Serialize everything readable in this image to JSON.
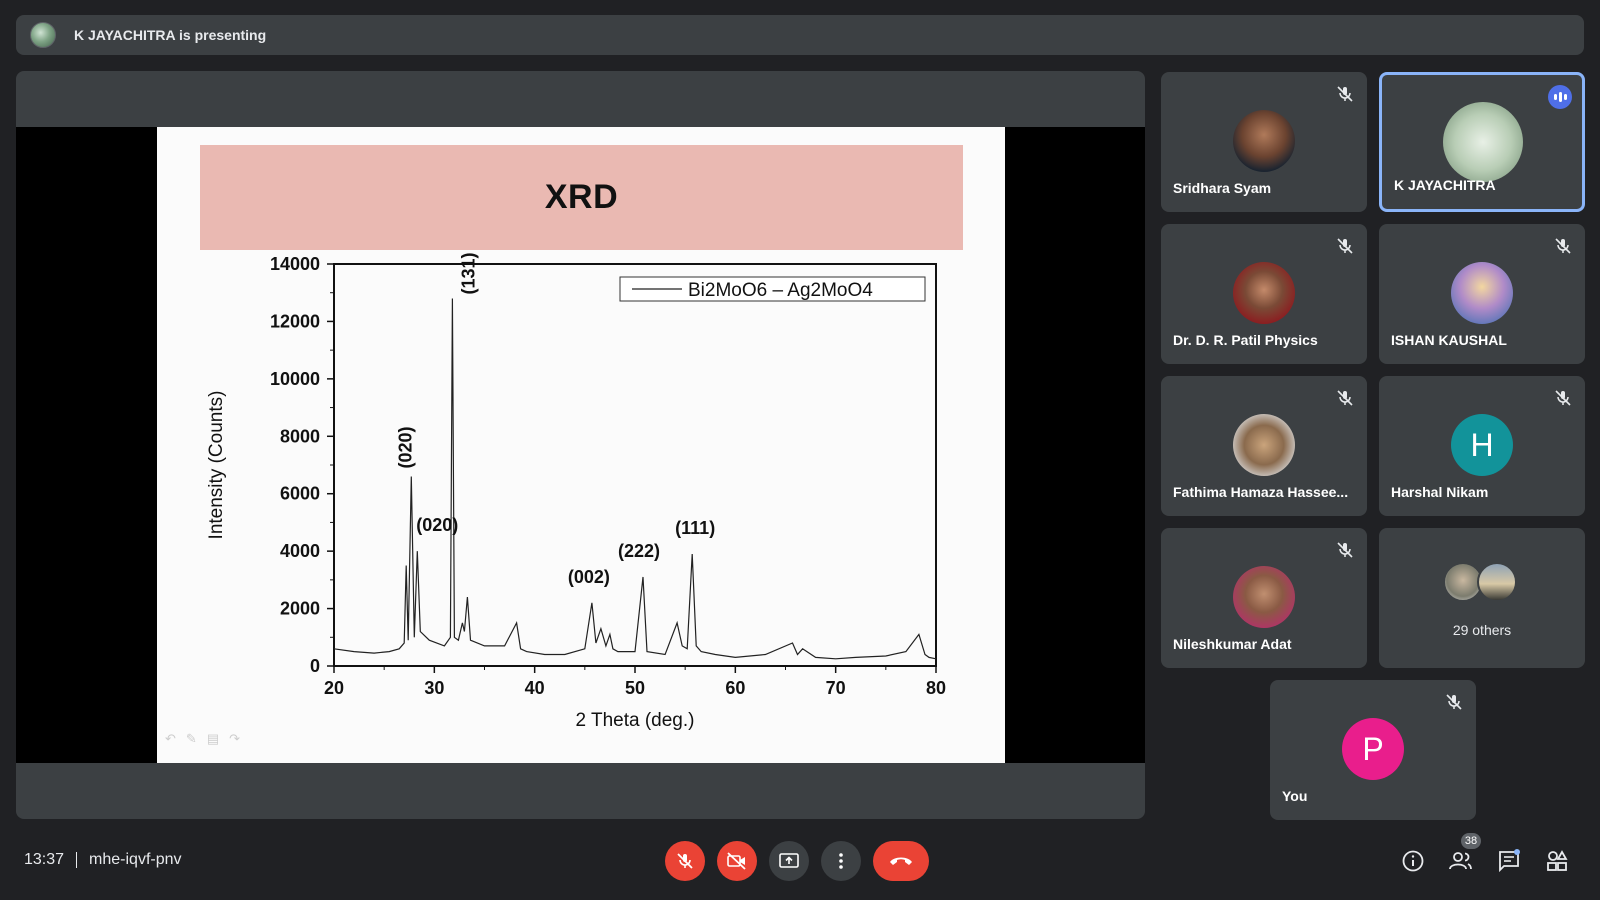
{
  "presenting": {
    "text": "K JAYACHITRA is presenting"
  },
  "slide": {
    "title": "XRD",
    "peak_labels": [
      "(131)",
      "(020)",
      "(020)",
      "(002)",
      "(222)",
      "(111)"
    ]
  },
  "chart_data": {
    "type": "line",
    "xlabel": "2 Theta (deg.)",
    "ylabel": "Intensity (Counts)",
    "xlim": [
      20,
      80
    ],
    "ylim": [
      0,
      14000
    ],
    "x_ticks": [
      "20",
      "30",
      "40",
      "50",
      "60",
      "70",
      "80"
    ],
    "y_ticks": [
      "0",
      "2000",
      "4000",
      "6000",
      "8000",
      "10000",
      "12000",
      "14000"
    ],
    "legend_position": "top-right",
    "series": [
      {
        "name": "Bi2MoO6 – Ag2MoO4",
        "x": [
          20,
          22,
          24,
          25.5,
          26.5,
          27.0,
          27.2,
          27.4,
          27.7,
          28.0,
          28.3,
          28.6,
          29.5,
          31.0,
          31.6,
          31.8,
          32.0,
          32.4,
          32.8,
          33.0,
          33.3,
          33.6,
          35,
          37,
          38.2,
          38.6,
          39.2,
          41,
          43,
          45.0,
          45.7,
          46.1,
          46.6,
          47.1,
          47.5,
          47.8,
          48.3,
          50.0,
          50.8,
          51.2,
          53.0,
          54.2,
          54.7,
          55.2,
          55.7,
          56.1,
          56.6,
          58,
          60,
          63,
          65.7,
          66.2,
          66.7,
          68,
          70,
          72,
          75,
          77,
          78.3,
          78.9,
          79.3,
          80
        ],
        "values": [
          600,
          500,
          450,
          500,
          600,
          800,
          3500,
          900,
          6600,
          1000,
          4000,
          1200,
          900,
          700,
          1000,
          12800,
          1000,
          900,
          1500,
          1200,
          2400,
          900,
          700,
          700,
          1500,
          600,
          500,
          400,
          400,
          600,
          2200,
          800,
          1300,
          700,
          1100,
          600,
          500,
          500,
          3100,
          500,
          400,
          1500,
          700,
          600,
          3900,
          700,
          500,
          400,
          300,
          400,
          800,
          400,
          600,
          300,
          250,
          300,
          350,
          500,
          1100,
          400,
          300,
          250
        ]
      }
    ],
    "annotations": [
      {
        "text": "(131)",
        "x": 32.0,
        "y": 12800
      },
      {
        "text": "(020)",
        "x": 27.7,
        "y": 6600
      },
      {
        "text": "(020)",
        "x": 28.3,
        "y": 4000
      },
      {
        "text": "(002)",
        "x": 45.7,
        "y": 2200
      },
      {
        "text": "(222)",
        "x": 50.8,
        "y": 3100
      },
      {
        "text": "(111)",
        "x": 55.7,
        "y": 3900
      }
    ]
  },
  "participants": [
    {
      "name": "Sridhara Syam",
      "muted": true
    },
    {
      "name": "K JAYACHITRA",
      "speaking": true
    },
    {
      "name": "Dr. D. R. Patil Physics",
      "muted": true
    },
    {
      "name": "ISHAN KAUSHAL",
      "muted": true
    },
    {
      "name": "Fathima Hamaza Hassee...",
      "muted": true
    },
    {
      "name": "Harshal Nikam",
      "muted": true,
      "initial": "H",
      "color": "#12939a"
    },
    {
      "name": "Nileshkumar Adat",
      "muted": true
    },
    {
      "name": "You",
      "muted": true,
      "initial": "P",
      "color": "#e91e8c"
    }
  ],
  "others": {
    "label": "29 others"
  },
  "meeting": {
    "time": "13:37",
    "code": "mhe-iqvf-pnv",
    "participant_count": "38"
  },
  "colors": {
    "end_call": "#ea4335",
    "speaking": "#4f6fe8",
    "active_border": "#8ab4f8"
  },
  "icons": [
    "mic-off-icon",
    "camera-off-icon",
    "present-icon",
    "more-icon",
    "end-call-icon",
    "info-icon",
    "people-icon",
    "chat-icon",
    "activities-icon"
  ]
}
